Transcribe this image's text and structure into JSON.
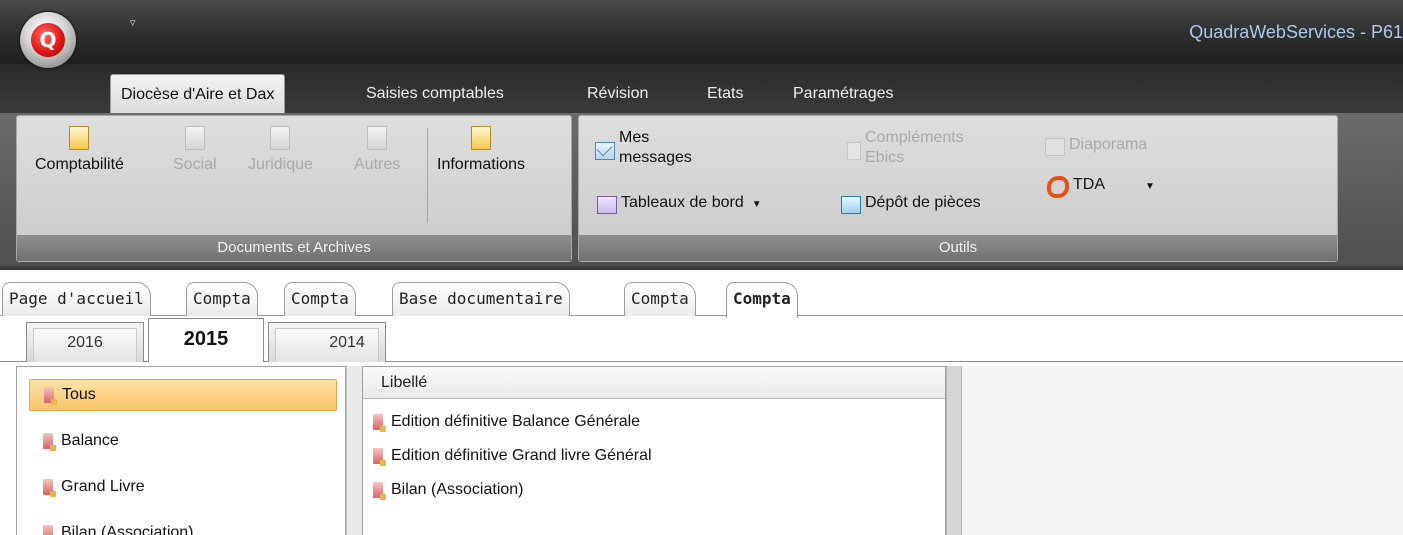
{
  "window": {
    "title": "QuadraWebServices - P61",
    "quick_access": "▿"
  },
  "ribbon": {
    "tabs": [
      {
        "label": "Diocèse d'Aire et Dax",
        "active": true
      },
      {
        "label": "Saisies comptables"
      },
      {
        "label": "Révision"
      },
      {
        "label": "Etats"
      },
      {
        "label": "Paramétrages"
      }
    ],
    "groups": {
      "documents": {
        "caption": "Documents et Archives",
        "buttons": [
          {
            "label": "Comptabilité",
            "enabled": true
          },
          {
            "label": "Social",
            "enabled": false
          },
          {
            "label": "Juridique",
            "enabled": false
          },
          {
            "label": "Autres",
            "enabled": false
          },
          {
            "label": "Informations",
            "enabled": true
          }
        ]
      },
      "outils": {
        "caption": "Outils",
        "mes_messages_line1": "Mes",
        "mes_messages_line2": "messages",
        "complements_line1": "Compléments",
        "complements_line2": "Ebics",
        "diaporama": "Diaporama",
        "tableaux": "Tableaux de bord",
        "depot": "Dépôt de pièces",
        "tda": "TDA"
      }
    }
  },
  "doc_tabs": [
    {
      "label": "Page d'accueil"
    },
    {
      "label": "Compta"
    },
    {
      "label": "Compta"
    },
    {
      "label": "Base documentaire"
    },
    {
      "label": "Compta"
    },
    {
      "label": "Compta",
      "active": true
    }
  ],
  "year_tabs": [
    {
      "label": "2016"
    },
    {
      "label": "2015",
      "active": true
    },
    {
      "label": "2014"
    }
  ],
  "categories": [
    {
      "label": "Tous",
      "selected": true
    },
    {
      "label": "Balance"
    },
    {
      "label": "Grand Livre"
    },
    {
      "label": "Bilan (Association)"
    }
  ],
  "document_list": {
    "header": "Libellé",
    "rows": [
      {
        "label": "Edition définitive Balance Générale"
      },
      {
        "label": "Edition définitive Grand livre Général"
      },
      {
        "label": "Bilan (Association)"
      }
    ]
  },
  "colors": {
    "ribbon_dark": "#2e2e2e",
    "title_text": "#a9c9ee",
    "selection": "#f9c36a",
    "tda_brand": "#e8501b"
  }
}
